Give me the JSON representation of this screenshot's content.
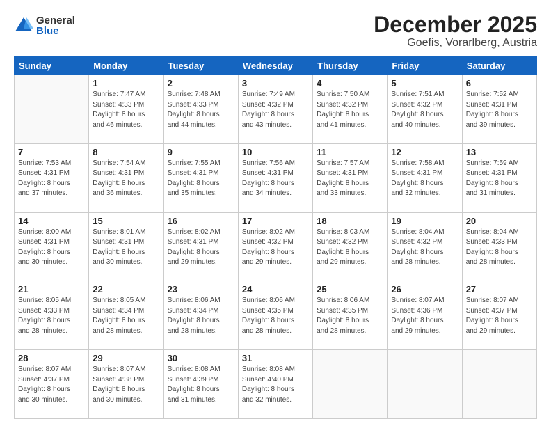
{
  "header": {
    "logo_general": "General",
    "logo_blue": "Blue",
    "title": "December 2025",
    "subtitle": "Goefis, Vorarlberg, Austria"
  },
  "days_of_week": [
    "Sunday",
    "Monday",
    "Tuesday",
    "Wednesday",
    "Thursday",
    "Friday",
    "Saturday"
  ],
  "weeks": [
    [
      {
        "day": "",
        "info": ""
      },
      {
        "day": "1",
        "info": "Sunrise: 7:47 AM\nSunset: 4:33 PM\nDaylight: 8 hours\nand 46 minutes."
      },
      {
        "day": "2",
        "info": "Sunrise: 7:48 AM\nSunset: 4:33 PM\nDaylight: 8 hours\nand 44 minutes."
      },
      {
        "day": "3",
        "info": "Sunrise: 7:49 AM\nSunset: 4:32 PM\nDaylight: 8 hours\nand 43 minutes."
      },
      {
        "day": "4",
        "info": "Sunrise: 7:50 AM\nSunset: 4:32 PM\nDaylight: 8 hours\nand 41 minutes."
      },
      {
        "day": "5",
        "info": "Sunrise: 7:51 AM\nSunset: 4:32 PM\nDaylight: 8 hours\nand 40 minutes."
      },
      {
        "day": "6",
        "info": "Sunrise: 7:52 AM\nSunset: 4:31 PM\nDaylight: 8 hours\nand 39 minutes."
      }
    ],
    [
      {
        "day": "7",
        "info": "Sunrise: 7:53 AM\nSunset: 4:31 PM\nDaylight: 8 hours\nand 37 minutes."
      },
      {
        "day": "8",
        "info": "Sunrise: 7:54 AM\nSunset: 4:31 PM\nDaylight: 8 hours\nand 36 minutes."
      },
      {
        "day": "9",
        "info": "Sunrise: 7:55 AM\nSunset: 4:31 PM\nDaylight: 8 hours\nand 35 minutes."
      },
      {
        "day": "10",
        "info": "Sunrise: 7:56 AM\nSunset: 4:31 PM\nDaylight: 8 hours\nand 34 minutes."
      },
      {
        "day": "11",
        "info": "Sunrise: 7:57 AM\nSunset: 4:31 PM\nDaylight: 8 hours\nand 33 minutes."
      },
      {
        "day": "12",
        "info": "Sunrise: 7:58 AM\nSunset: 4:31 PM\nDaylight: 8 hours\nand 32 minutes."
      },
      {
        "day": "13",
        "info": "Sunrise: 7:59 AM\nSunset: 4:31 PM\nDaylight: 8 hours\nand 31 minutes."
      }
    ],
    [
      {
        "day": "14",
        "info": "Sunrise: 8:00 AM\nSunset: 4:31 PM\nDaylight: 8 hours\nand 30 minutes."
      },
      {
        "day": "15",
        "info": "Sunrise: 8:01 AM\nSunset: 4:31 PM\nDaylight: 8 hours\nand 30 minutes."
      },
      {
        "day": "16",
        "info": "Sunrise: 8:02 AM\nSunset: 4:31 PM\nDaylight: 8 hours\nand 29 minutes."
      },
      {
        "day": "17",
        "info": "Sunrise: 8:02 AM\nSunset: 4:32 PM\nDaylight: 8 hours\nand 29 minutes."
      },
      {
        "day": "18",
        "info": "Sunrise: 8:03 AM\nSunset: 4:32 PM\nDaylight: 8 hours\nand 29 minutes."
      },
      {
        "day": "19",
        "info": "Sunrise: 8:04 AM\nSunset: 4:32 PM\nDaylight: 8 hours\nand 28 minutes."
      },
      {
        "day": "20",
        "info": "Sunrise: 8:04 AM\nSunset: 4:33 PM\nDaylight: 8 hours\nand 28 minutes."
      }
    ],
    [
      {
        "day": "21",
        "info": "Sunrise: 8:05 AM\nSunset: 4:33 PM\nDaylight: 8 hours\nand 28 minutes."
      },
      {
        "day": "22",
        "info": "Sunrise: 8:05 AM\nSunset: 4:34 PM\nDaylight: 8 hours\nand 28 minutes."
      },
      {
        "day": "23",
        "info": "Sunrise: 8:06 AM\nSunset: 4:34 PM\nDaylight: 8 hours\nand 28 minutes."
      },
      {
        "day": "24",
        "info": "Sunrise: 8:06 AM\nSunset: 4:35 PM\nDaylight: 8 hours\nand 28 minutes."
      },
      {
        "day": "25",
        "info": "Sunrise: 8:06 AM\nSunset: 4:35 PM\nDaylight: 8 hours\nand 28 minutes."
      },
      {
        "day": "26",
        "info": "Sunrise: 8:07 AM\nSunset: 4:36 PM\nDaylight: 8 hours\nand 29 minutes."
      },
      {
        "day": "27",
        "info": "Sunrise: 8:07 AM\nSunset: 4:37 PM\nDaylight: 8 hours\nand 29 minutes."
      }
    ],
    [
      {
        "day": "28",
        "info": "Sunrise: 8:07 AM\nSunset: 4:37 PM\nDaylight: 8 hours\nand 30 minutes."
      },
      {
        "day": "29",
        "info": "Sunrise: 8:07 AM\nSunset: 4:38 PM\nDaylight: 8 hours\nand 30 minutes."
      },
      {
        "day": "30",
        "info": "Sunrise: 8:08 AM\nSunset: 4:39 PM\nDaylight: 8 hours\nand 31 minutes."
      },
      {
        "day": "31",
        "info": "Sunrise: 8:08 AM\nSunset: 4:40 PM\nDaylight: 8 hours\nand 32 minutes."
      },
      {
        "day": "",
        "info": ""
      },
      {
        "day": "",
        "info": ""
      },
      {
        "day": "",
        "info": ""
      }
    ]
  ]
}
